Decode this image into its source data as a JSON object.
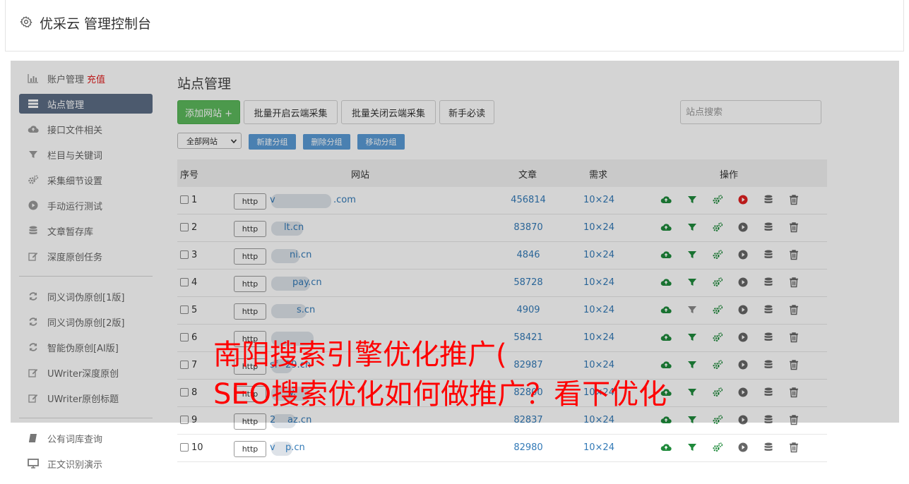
{
  "header": {
    "title": "优采云 管理控制台",
    "icon": "gear-icon"
  },
  "sidebar": {
    "items": [
      {
        "label": "账户管理",
        "extra": "充值",
        "icon": "bar-chart-icon"
      },
      {
        "label": "站点管理",
        "icon": "list-icon",
        "active": true
      },
      {
        "label": "接口文件相关",
        "icon": "cloud-upload-icon"
      },
      {
        "label": "栏目与关键词",
        "icon": "filter-icon"
      },
      {
        "label": "采集细节设置",
        "icon": "gears-icon"
      },
      {
        "label": "手动运行测试",
        "icon": "play-circle-icon"
      },
      {
        "label": "文章暂存库",
        "icon": "database-icon"
      },
      {
        "label": "深度原创任务",
        "icon": "edit-icon"
      },
      {
        "label": "同义词伪原创[1版]",
        "icon": "refresh-icon"
      },
      {
        "label": "同义词伪原创[2版]",
        "icon": "refresh-icon"
      },
      {
        "label": "智能伪原创[AI版]",
        "icon": "refresh-icon"
      },
      {
        "label": "UWriter深度原创",
        "icon": "edit-icon"
      },
      {
        "label": "UWriter原创标题",
        "icon": "edit-icon"
      },
      {
        "label": "公有词库查询",
        "icon": "book-icon"
      },
      {
        "label": "正文识别演示",
        "icon": "monitor-icon"
      }
    ]
  },
  "main": {
    "title": "站点管理",
    "toolbar": {
      "add_site": "添加网站 +",
      "batch_on": "批量开启云端采集",
      "batch_off": "批量关闭云端采集",
      "guide": "新手必读",
      "search_placeholder": "站点搜索"
    },
    "group": {
      "select_value": "全部网站",
      "new_group": "新建分组",
      "delete_group": "删除分组",
      "move_group": "移动分组"
    },
    "table": {
      "headers": {
        "index": "序号",
        "site": "网站",
        "articles": "文章",
        "need": "需求",
        "ops": "操作"
      },
      "rows": [
        {
          "num": "1",
          "protocol": "http",
          "site_prefix": "v",
          "site_suffix": ".com",
          "articles": "456814",
          "need": "10×24",
          "play_active": true,
          "filter_active": true
        },
        {
          "num": "2",
          "protocol": "http",
          "site_prefix": "",
          "site_suffix": "lt.cn",
          "articles": "83870",
          "need": "10×24",
          "play_active": false,
          "filter_active": true
        },
        {
          "num": "3",
          "protocol": "http",
          "site_prefix": "",
          "site_suffix": "ni.cn",
          "articles": "4846",
          "need": "10×24",
          "play_active": false,
          "filter_active": true
        },
        {
          "num": "4",
          "protocol": "http",
          "site_prefix": "",
          "site_suffix": "pay.cn",
          "articles": "58728",
          "need": "10×24",
          "play_active": false,
          "filter_active": true
        },
        {
          "num": "5",
          "protocol": "http",
          "site_prefix": "",
          "site_suffix": "s.cn",
          "articles": "4909",
          "need": "10×24",
          "play_active": false,
          "filter_active": false
        },
        {
          "num": "6",
          "protocol": "http",
          "site_prefix": "",
          "site_suffix": "",
          "articles": "58421",
          "need": "10×24",
          "play_active": false,
          "filter_active": true
        },
        {
          "num": "7",
          "protocol": "http",
          "site_prefix": "sf",
          "site_suffix": "29.cn",
          "articles": "82987",
          "need": "10×24",
          "play_active": false,
          "filter_active": true
        },
        {
          "num": "8",
          "protocol": "http",
          "site_prefix": "",
          "site_suffix": "y.",
          "articles": "82800",
          "need": "10×24",
          "play_active": false,
          "filter_active": true
        },
        {
          "num": "9",
          "protocol": "http",
          "site_prefix": "2",
          "site_suffix": "az.cn",
          "articles": "82837",
          "need": "10×24",
          "play_active": false,
          "filter_active": true
        },
        {
          "num": "10",
          "protocol": "http",
          "site_prefix": "v",
          "site_suffix": "p.cn",
          "articles": "82980",
          "need": "10×24",
          "play_active": false,
          "filter_active": true
        }
      ]
    }
  },
  "overlay_text": {
    "line1": "南阳搜索引擎优化推广(",
    "line2": "SEO搜索优化如何做推广？看下优化"
  },
  "colors": {
    "accent_green": "#5cb85c",
    "link_blue": "#337ab7",
    "group_blue": "#5a9bd5",
    "active_nav": "#5c6d85",
    "headline_red": "#ff0000",
    "play_red": "#e02020"
  }
}
